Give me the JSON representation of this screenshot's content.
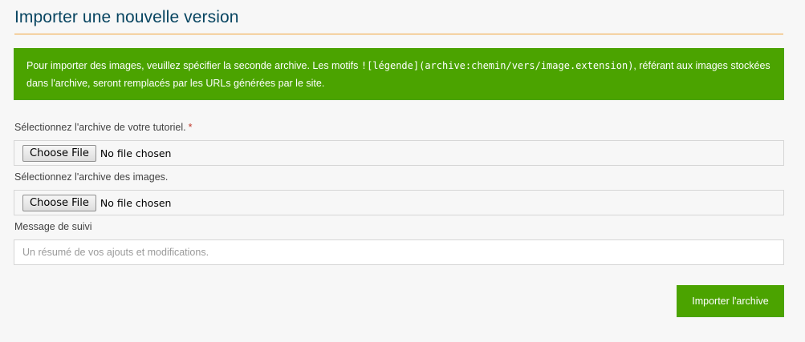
{
  "header": {
    "title": "Importer une nouvelle version"
  },
  "alert": {
    "text_before": "Pour importer des images, veuillez spécifier la seconde archive. Les motifs ",
    "code": "![légende](archive:chemin/vers/image.extension)",
    "text_after": ", référant aux images stockées dans l'archive, seront remplacés par les URLs générées par le site.",
    "color": "#4ba300"
  },
  "form": {
    "tutorial_archive": {
      "label": "Sélectionnez l'archive de votre tutoriel.",
      "required_mark": "*",
      "button_label": "Choose File",
      "status": "No file chosen"
    },
    "images_archive": {
      "label": "Sélectionnez l'archive des images.",
      "button_label": "Choose File",
      "status": "No file chosen"
    },
    "message": {
      "label": "Message de suivi",
      "placeholder": "Un résumé de vos ajouts et modifications.",
      "value": ""
    },
    "submit_label": "Importer l'archive"
  },
  "colors": {
    "title": "#084561",
    "accent_rule": "#f0a43c",
    "success_green": "#4ba300",
    "required_red": "#c0392b"
  }
}
